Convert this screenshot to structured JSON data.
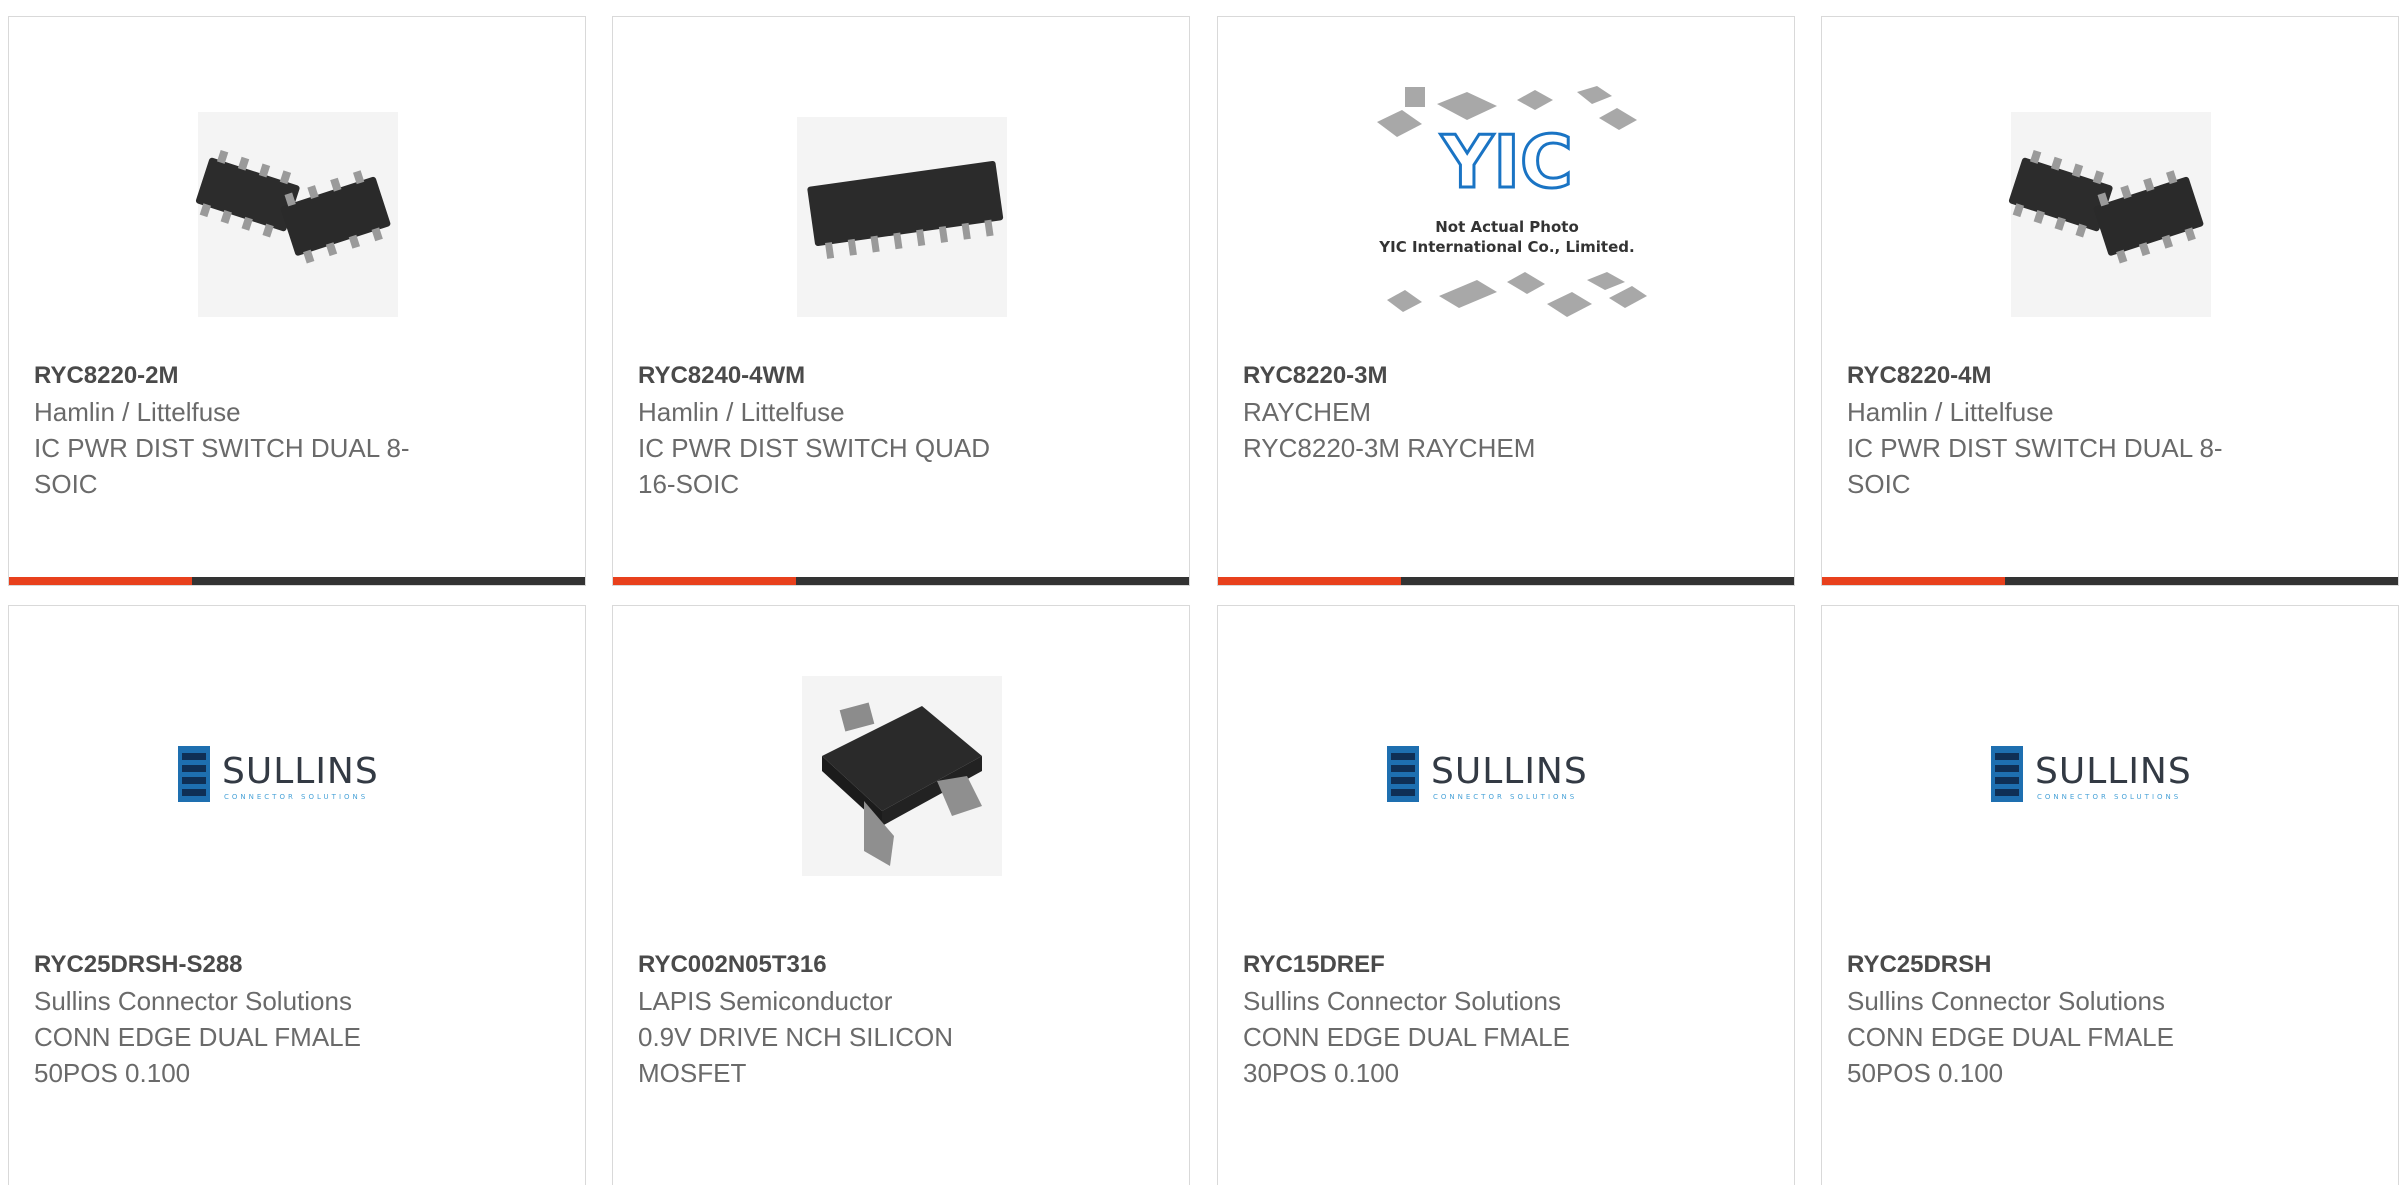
{
  "accent_color": "#e8401c",
  "bar_color": "#333333",
  "products": [
    {
      "part_number": "RYC8220-2M",
      "manufacturer": "Hamlin / Littelfuse",
      "description": "IC PWR DIST SWITCH DUAL 8-\nSOIC",
      "image": "soic8-dual-photo"
    },
    {
      "part_number": "RYC8240-4WM",
      "manufacturer": "Hamlin / Littelfuse",
      "description": "IC PWR DIST SWITCH QUAD\n16-SOIC",
      "image": "soic16-photo"
    },
    {
      "part_number": "RYC8220-3M",
      "manufacturer": "RAYCHEM",
      "description": "RYC8220-3M RAYCHEM",
      "image": "yic-placeholder",
      "image_caption_line1": "Not Actual Photo",
      "image_caption_line2": "YIC International Co., Limited.",
      "image_logo_text": "YIC"
    },
    {
      "part_number": "RYC8220-4M",
      "manufacturer": "Hamlin / Littelfuse",
      "description": "IC PWR DIST SWITCH DUAL 8-\nSOIC",
      "image": "soic8-dual-photo"
    },
    {
      "part_number": "RYC25DRSH-S288",
      "manufacturer": "Sullins Connector Solutions",
      "description": "CONN EDGE DUAL FMALE\n50POS 0.100",
      "image": "sullins-logo",
      "image_logo_text": "SULLINS",
      "image_logo_subtext": "CONNECTOR SOLUTIONS"
    },
    {
      "part_number": "RYC002N05T316",
      "manufacturer": "LAPIS Semiconductor",
      "description": "0.9V DRIVE NCH SILICON\nMOSFET",
      "image": "sot-transistor-photo"
    },
    {
      "part_number": "RYC15DREF",
      "manufacturer": "Sullins Connector Solutions",
      "description": "CONN EDGE DUAL FMALE\n30POS 0.100",
      "image": "sullins-logo",
      "image_logo_text": "SULLINS",
      "image_logo_subtext": "CONNECTOR SOLUTIONS"
    },
    {
      "part_number": "RYC25DRSH",
      "manufacturer": "Sullins Connector Solutions",
      "description": "CONN EDGE DUAL FMALE\n50POS 0.100",
      "image": "sullins-logo",
      "image_logo_text": "SULLINS",
      "image_logo_subtext": "CONNECTOR SOLUTIONS"
    }
  ]
}
